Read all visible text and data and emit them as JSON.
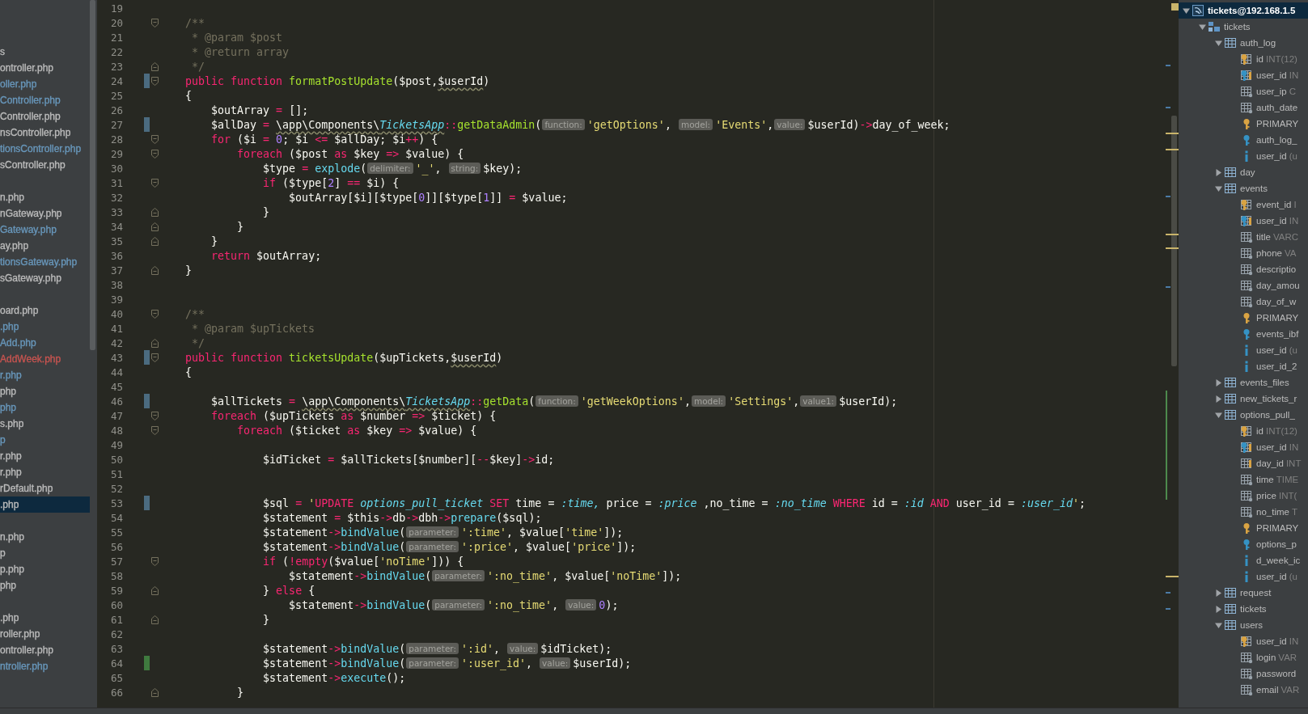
{
  "project": {
    "groups": [
      {
        "items": [
          {
            "name": "s",
            "color": "#bbbbbb",
            "selected": false
          },
          {
            "name": "ontroller.php",
            "color": "#bbbbbb",
            "selected": false
          },
          {
            "name": "oller.php",
            "color": "#6897bb",
            "selected": false
          },
          {
            "name": "Controller.php",
            "color": "#6897bb",
            "selected": false
          },
          {
            "name": "Controller.php",
            "color": "#bbbbbb",
            "selected": false
          },
          {
            "name": "nsController.php",
            "color": "#bbbbbb",
            "selected": false
          },
          {
            "name": "tionsController.php",
            "color": "#6897bb",
            "selected": false
          },
          {
            "name": "sController.php",
            "color": "#bbbbbb",
            "selected": false
          }
        ]
      },
      {
        "items": [
          {
            "name": "n.php",
            "color": "#bbbbbb",
            "selected": false
          },
          {
            "name": "nGateway.php",
            "color": "#bbbbbb",
            "selected": false
          },
          {
            "name": "Gateway.php",
            "color": "#6897bb",
            "selected": false
          },
          {
            "name": "ay.php",
            "color": "#bbbbbb",
            "selected": false
          },
          {
            "name": "tionsGateway.php",
            "color": "#6897bb",
            "selected": false
          },
          {
            "name": "sGateway.php",
            "color": "#bbbbbb",
            "selected": false
          }
        ]
      },
      {
        "items": [
          {
            "name": "oard.php",
            "color": "#bbbbbb",
            "selected": false
          },
          {
            "name": ".php",
            "color": "#6897bb",
            "selected": false
          },
          {
            "name": "Add.php",
            "color": "#6897bb",
            "selected": false
          },
          {
            "name": "AddWeek.php",
            "color": "#c75450",
            "selected": false
          },
          {
            "name": "r.php",
            "color": "#6897bb",
            "selected": false
          },
          {
            "name": "php",
            "color": "#bbbbbb",
            "selected": false
          },
          {
            "name": "php",
            "color": "#6897bb",
            "selected": false
          },
          {
            "name": "s.php",
            "color": "#bbbbbb",
            "selected": false
          },
          {
            "name": "p",
            "color": "#6897bb",
            "selected": false
          },
          {
            "name": "r.php",
            "color": "#bbbbbb",
            "selected": false
          },
          {
            "name": "r.php",
            "color": "#bbbbbb",
            "selected": false
          },
          {
            "name": "rDefault.php",
            "color": "#bbbbbb",
            "selected": false
          },
          {
            "name": ".php",
            "color": "#bbbbbb",
            "selected": true
          }
        ]
      },
      {
        "items": [
          {
            "name": "n.php",
            "color": "#bbbbbb",
            "selected": false
          },
          {
            "name": "p",
            "color": "#bbbbbb",
            "selected": false
          },
          {
            "name": "p.php",
            "color": "#bbbbbb",
            "selected": false
          },
          {
            "name": "php",
            "color": "#bbbbbb",
            "selected": false
          }
        ]
      },
      {
        "items": [
          {
            "name": ".php",
            "color": "#bbbbbb",
            "selected": false
          },
          {
            "name": "roller.php",
            "color": "#bbbbbb",
            "selected": false
          },
          {
            "name": "ontroller.php",
            "color": "#bbbbbb",
            "selected": false
          },
          {
            "name": "ntroller.php",
            "color": "#6897bb",
            "selected": false
          }
        ]
      }
    ]
  },
  "editor": {
    "lines": [
      {
        "n": "19"
      },
      {
        "n": "20",
        "fold": {
          "kind": "open"
        },
        "tokens": [
          {
            "kind": "cm",
            "text": "    /**"
          }
        ]
      },
      {
        "n": "21",
        "tokens": [
          {
            "kind": "cm",
            "text": "     * @param $post"
          }
        ]
      },
      {
        "n": "22",
        "tokens": [
          {
            "kind": "cm",
            "text": "     * @return array"
          }
        ]
      },
      {
        "n": "23",
        "fold": {
          "kind": "close"
        },
        "tokens": [
          {
            "kind": "cm",
            "text": "     */"
          }
        ]
      },
      {
        "n": "24",
        "fold": {
          "kind": "open"
        },
        "change": {
          "color": "#4b6b80"
        },
        "tokens": [
          {
            "kind": "kw",
            "text": "    public function "
          },
          {
            "kind": "fn",
            "text": "formatPostUpdate"
          },
          {
            "kind": "txt",
            "text": "($post,"
          },
          {
            "kind": "warn",
            "text": "$userId"
          },
          {
            "kind": "txt",
            "text": ")"
          }
        ]
      },
      {
        "n": "25",
        "tokens": [
          {
            "kind": "txt",
            "text": "    {"
          }
        ]
      },
      {
        "n": "26",
        "tokens": [
          {
            "kind": "txt",
            "text": "        $outArray "
          },
          {
            "kind": "kw",
            "text": "="
          },
          {
            "kind": "txt",
            "text": " [];"
          }
        ]
      },
      {
        "n": "27",
        "change": {
          "color": "#4b6b80"
        },
        "tokens": [
          {
            "kind": "txt",
            "text": "        $allDay "
          },
          {
            "kind": "kw",
            "text": "= "
          },
          {
            "kind": "ns",
            "text": "\\app\\Components\\"
          },
          {
            "kind": "cls",
            "text": "TicketsApp"
          },
          {
            "kind": "kw",
            "text": "::"
          },
          {
            "kind": "fn",
            "text": "getDataAdmin"
          },
          {
            "kind": "txt",
            "text": "("
          },
          {
            "kind": "hint",
            "text": "function:"
          },
          {
            "kind": "str",
            "text": "'getOptions'"
          },
          {
            "kind": "txt",
            "text": ", "
          },
          {
            "kind": "hint",
            "text": "model:"
          },
          {
            "kind": "str",
            "text": "'Events'"
          },
          {
            "kind": "txt",
            "text": ","
          },
          {
            "kind": "hint",
            "text": "value:"
          },
          {
            "kind": "txt",
            "text": "$userId)"
          },
          {
            "kind": "kw",
            "text": "->"
          },
          {
            "kind": "txt",
            "text": "day_of_week;"
          }
        ]
      },
      {
        "n": "28",
        "fold": {
          "kind": "open"
        },
        "tokens": [
          {
            "kind": "kw",
            "text": "        for"
          },
          {
            "kind": "txt",
            "text": " ($i "
          },
          {
            "kind": "kw",
            "text": "= "
          },
          {
            "kind": "num",
            "text": "0"
          },
          {
            "kind": "txt",
            "text": "; $i "
          },
          {
            "kind": "kw",
            "text": "<="
          },
          {
            "kind": "txt",
            "text": " $allDay; $i"
          },
          {
            "kind": "kw",
            "text": "++"
          },
          {
            "kind": "txt",
            "text": ") {"
          }
        ]
      },
      {
        "n": "29",
        "fold": {
          "kind": "open"
        },
        "tokens": [
          {
            "kind": "kw",
            "text": "            foreach"
          },
          {
            "kind": "txt",
            "text": " ($post "
          },
          {
            "kind": "kw",
            "text": "as"
          },
          {
            "kind": "txt",
            "text": " $key "
          },
          {
            "kind": "kw",
            "text": "=>"
          },
          {
            "kind": "txt",
            "text": " $value) {"
          }
        ]
      },
      {
        "n": "30",
        "tokens": [
          {
            "kind": "txt",
            "text": "                $type "
          },
          {
            "kind": "kw",
            "text": "= "
          },
          {
            "kind": "call",
            "text": "explode"
          },
          {
            "kind": "txt",
            "text": "("
          },
          {
            "kind": "hint",
            "text": "delimiter:"
          },
          {
            "kind": "str",
            "text": "'_'"
          },
          {
            "kind": "txt",
            "text": ", "
          },
          {
            "kind": "hint",
            "text": "string:"
          },
          {
            "kind": "txt",
            "text": "$key);"
          }
        ]
      },
      {
        "n": "31",
        "fold": {
          "kind": "open"
        },
        "tokens": [
          {
            "kind": "kw",
            "text": "                if"
          },
          {
            "kind": "txt",
            "text": " ($type["
          },
          {
            "kind": "num",
            "text": "2"
          },
          {
            "kind": "txt",
            "text": "] "
          },
          {
            "kind": "kw",
            "text": "=="
          },
          {
            "kind": "txt",
            "text": " $i) {"
          }
        ]
      },
      {
        "n": "32",
        "tokens": [
          {
            "kind": "txt",
            "text": "                    $outArray[$i][$type["
          },
          {
            "kind": "num",
            "text": "0"
          },
          {
            "kind": "txt",
            "text": "]][$type["
          },
          {
            "kind": "num",
            "text": "1"
          },
          {
            "kind": "txt",
            "text": "]] "
          },
          {
            "kind": "kw",
            "text": "="
          },
          {
            "kind": "txt",
            "text": " $value;"
          }
        ]
      },
      {
        "n": "33",
        "fold": {
          "kind": "close"
        },
        "tokens": [
          {
            "kind": "txt",
            "text": "                }"
          }
        ]
      },
      {
        "n": "34",
        "fold": {
          "kind": "close"
        },
        "tokens": [
          {
            "kind": "txt",
            "text": "            }"
          }
        ]
      },
      {
        "n": "35",
        "fold": {
          "kind": "close"
        },
        "tokens": [
          {
            "kind": "txt",
            "text": "        }"
          }
        ]
      },
      {
        "n": "36",
        "tokens": [
          {
            "kind": "kw",
            "text": "        return"
          },
          {
            "kind": "txt",
            "text": " $outArray;"
          }
        ]
      },
      {
        "n": "37",
        "fold": {
          "kind": "close"
        },
        "tokens": [
          {
            "kind": "txt",
            "text": "    }"
          }
        ]
      },
      {
        "n": "38"
      },
      {
        "n": "39"
      },
      {
        "n": "40",
        "fold": {
          "kind": "open"
        },
        "tokens": [
          {
            "kind": "cm",
            "text": "    /**"
          }
        ]
      },
      {
        "n": "41",
        "tokens": [
          {
            "kind": "cm",
            "text": "     * @param $upTickets"
          }
        ]
      },
      {
        "n": "42",
        "fold": {
          "kind": "close"
        },
        "tokens": [
          {
            "kind": "cm",
            "text": "     */"
          }
        ]
      },
      {
        "n": "43",
        "fold": {
          "kind": "open"
        },
        "change": {
          "color": "#4b6b80"
        },
        "tokens": [
          {
            "kind": "kw",
            "text": "    public function "
          },
          {
            "kind": "fn",
            "text": "ticketsUpdate"
          },
          {
            "kind": "txt",
            "text": "($upTickets,"
          },
          {
            "kind": "warn",
            "text": "$userId"
          },
          {
            "kind": "txt",
            "text": ")"
          }
        ]
      },
      {
        "n": "44",
        "tokens": [
          {
            "kind": "txt",
            "text": "    {"
          }
        ]
      },
      {
        "n": "45"
      },
      {
        "n": "46",
        "change": {
          "color": "#4b6b80"
        },
        "tokens": [
          {
            "kind": "txt",
            "text": "        $allTickets "
          },
          {
            "kind": "kw",
            "text": "= "
          },
          {
            "kind": "ns",
            "text": "\\app\\Components\\"
          },
          {
            "kind": "cls",
            "text": "TicketsApp"
          },
          {
            "kind": "kw",
            "text": "::"
          },
          {
            "kind": "fn",
            "text": "getData"
          },
          {
            "kind": "txt",
            "text": "("
          },
          {
            "kind": "hint",
            "text": "function:"
          },
          {
            "kind": "str",
            "text": "'getWeekOptions'"
          },
          {
            "kind": "txt",
            "text": ","
          },
          {
            "kind": "hint",
            "text": "model:"
          },
          {
            "kind": "str",
            "text": "'Settings'"
          },
          {
            "kind": "txt",
            "text": ","
          },
          {
            "kind": "hint",
            "text": "value1:"
          },
          {
            "kind": "txt",
            "text": "$userId);"
          }
        ]
      },
      {
        "n": "47",
        "fold": {
          "kind": "open"
        },
        "tokens": [
          {
            "kind": "kw",
            "text": "        foreach"
          },
          {
            "kind": "txt",
            "text": " ($upTickets "
          },
          {
            "kind": "kw",
            "text": "as"
          },
          {
            "kind": "txt",
            "text": " $number "
          },
          {
            "kind": "kw",
            "text": "=>"
          },
          {
            "kind": "txt",
            "text": " $ticket) {"
          }
        ]
      },
      {
        "n": "48",
        "fold": {
          "kind": "open"
        },
        "tokens": [
          {
            "kind": "kw",
            "text": "            foreach"
          },
          {
            "kind": "txt",
            "text": " ($ticket "
          },
          {
            "kind": "kw",
            "text": "as"
          },
          {
            "kind": "txt",
            "text": " $key "
          },
          {
            "kind": "kw",
            "text": "=>"
          },
          {
            "kind": "txt",
            "text": " $value) {"
          }
        ]
      },
      {
        "n": "49"
      },
      {
        "n": "50",
        "tokens": [
          {
            "kind": "txt",
            "text": "                $idTicket "
          },
          {
            "kind": "kw",
            "text": "="
          },
          {
            "kind": "txt",
            "text": " $allTickets[$number]["
          },
          {
            "kind": "kw",
            "text": "--"
          },
          {
            "kind": "txt",
            "text": "$key]"
          },
          {
            "kind": "kw",
            "text": "->"
          },
          {
            "kind": "txt",
            "text": "id;"
          }
        ]
      },
      {
        "n": "51"
      },
      {
        "n": "52"
      },
      {
        "n": "53",
        "change": {
          "color": "#4b6b80"
        },
        "tokens": [
          {
            "kind": "txt",
            "text": "                $sql "
          },
          {
            "kind": "kw",
            "text": "= "
          },
          {
            "kind": "str",
            "text": "'"
          },
          {
            "kind": "sqlkw",
            "text": "UPDATE "
          },
          {
            "kind": "sqlid",
            "text": "options_pull_ticket "
          },
          {
            "kind": "sqlkw",
            "text": "SET"
          },
          {
            "kind": "txt",
            "text": " time = "
          },
          {
            "kind": "sqlid",
            "text": ":time,"
          },
          {
            "kind": "txt",
            "text": " price = "
          },
          {
            "kind": "sqlid",
            "text": ":price"
          },
          {
            "kind": "txt",
            "text": " ,no_time = "
          },
          {
            "kind": "sqlid",
            "text": ":no_time "
          },
          {
            "kind": "sqlkw",
            "text": "WHERE"
          },
          {
            "kind": "txt",
            "text": " id = "
          },
          {
            "kind": "sqlid",
            "text": ":id "
          },
          {
            "kind": "sqlkw",
            "text": "AND"
          },
          {
            "kind": "txt",
            "text": " user_id = "
          },
          {
            "kind": "sqlid",
            "text": ":user_id"
          },
          {
            "kind": "str",
            "text": "'"
          },
          {
            "kind": "txt",
            "text": ";"
          }
        ]
      },
      {
        "n": "54",
        "tokens": [
          {
            "kind": "txt",
            "text": "                $statement "
          },
          {
            "kind": "kw",
            "text": "="
          },
          {
            "kind": "txt",
            "text": " $this"
          },
          {
            "kind": "kw",
            "text": "->"
          },
          {
            "kind": "txt",
            "text": "db"
          },
          {
            "kind": "kw",
            "text": "->"
          },
          {
            "kind": "txt",
            "text": "dbh"
          },
          {
            "kind": "kw",
            "text": "->"
          },
          {
            "kind": "call",
            "text": "prepare"
          },
          {
            "kind": "txt",
            "text": "($sql);"
          }
        ]
      },
      {
        "n": "55",
        "tokens": [
          {
            "kind": "txt",
            "text": "                $statement"
          },
          {
            "kind": "kw",
            "text": "->"
          },
          {
            "kind": "call",
            "text": "bindValue"
          },
          {
            "kind": "txt",
            "text": "("
          },
          {
            "kind": "hint",
            "text": "parameter:"
          },
          {
            "kind": "str",
            "text": "':time'"
          },
          {
            "kind": "txt",
            "text": ", $value["
          },
          {
            "kind": "str",
            "text": "'time'"
          },
          {
            "kind": "txt",
            "text": "]);"
          }
        ]
      },
      {
        "n": "56",
        "tokens": [
          {
            "kind": "txt",
            "text": "                $statement"
          },
          {
            "kind": "kw",
            "text": "->"
          },
          {
            "kind": "call",
            "text": "bindValue"
          },
          {
            "kind": "txt",
            "text": "("
          },
          {
            "kind": "hint",
            "text": "parameter:"
          },
          {
            "kind": "str",
            "text": "':price'"
          },
          {
            "kind": "txt",
            "text": ", $value["
          },
          {
            "kind": "str",
            "text": "'price'"
          },
          {
            "kind": "txt",
            "text": "]);"
          }
        ]
      },
      {
        "n": "57",
        "fold": {
          "kind": "open"
        },
        "tokens": [
          {
            "kind": "kw",
            "text": "                if"
          },
          {
            "kind": "txt",
            "text": " ("
          },
          {
            "kind": "kw",
            "text": "!empty"
          },
          {
            "kind": "txt",
            "text": "($value["
          },
          {
            "kind": "str",
            "text": "'noTime'"
          },
          {
            "kind": "txt",
            "text": "])) {"
          }
        ]
      },
      {
        "n": "58",
        "tokens": [
          {
            "kind": "txt",
            "text": "                    $statement"
          },
          {
            "kind": "kw",
            "text": "->"
          },
          {
            "kind": "call",
            "text": "bindValue"
          },
          {
            "kind": "txt",
            "text": "("
          },
          {
            "kind": "hint",
            "text": "parameter:"
          },
          {
            "kind": "str",
            "text": "':no_time'"
          },
          {
            "kind": "txt",
            "text": ", $value["
          },
          {
            "kind": "str",
            "text": "'noTime'"
          },
          {
            "kind": "txt",
            "text": "]);"
          }
        ]
      },
      {
        "n": "59",
        "fold": {
          "kind": "close"
        },
        "tokens": [
          {
            "kind": "txt",
            "text": "                } "
          },
          {
            "kind": "kw",
            "text": "else"
          },
          {
            "kind": "txt",
            "text": " {"
          }
        ]
      },
      {
        "n": "60",
        "tokens": [
          {
            "kind": "txt",
            "text": "                    $statement"
          },
          {
            "kind": "kw",
            "text": "->"
          },
          {
            "kind": "call",
            "text": "bindValue"
          },
          {
            "kind": "txt",
            "text": "("
          },
          {
            "kind": "hint",
            "text": "parameter:"
          },
          {
            "kind": "str",
            "text": "':no_time'"
          },
          {
            "kind": "txt",
            "text": ", "
          },
          {
            "kind": "hint",
            "text": "value:"
          },
          {
            "kind": "num",
            "text": "0"
          },
          {
            "kind": "txt",
            "text": ");"
          }
        ]
      },
      {
        "n": "61",
        "fold": {
          "kind": "close"
        },
        "tokens": [
          {
            "kind": "txt",
            "text": "                }"
          }
        ]
      },
      {
        "n": "62"
      },
      {
        "n": "63",
        "tokens": [
          {
            "kind": "txt",
            "text": "                $statement"
          },
          {
            "kind": "kw",
            "text": "->"
          },
          {
            "kind": "call",
            "text": "bindValue"
          },
          {
            "kind": "txt",
            "text": "("
          },
          {
            "kind": "hint",
            "text": "parameter:"
          },
          {
            "kind": "str",
            "text": "':id'"
          },
          {
            "kind": "txt",
            "text": ", "
          },
          {
            "kind": "hint",
            "text": "value:"
          },
          {
            "kind": "txt",
            "text": "$idTicket);"
          }
        ]
      },
      {
        "n": "64",
        "change": {
          "color": "#3f7a3f"
        },
        "tokens": [
          {
            "kind": "txt",
            "text": "                $statement"
          },
          {
            "kind": "kw",
            "text": "->"
          },
          {
            "kind": "call",
            "text": "bindValue"
          },
          {
            "kind": "txt",
            "text": "("
          },
          {
            "kind": "hint",
            "text": "parameter:"
          },
          {
            "kind": "str",
            "text": "':user_id'"
          },
          {
            "kind": "txt",
            "text": ", "
          },
          {
            "kind": "hint",
            "text": "value:"
          },
          {
            "kind": "txt",
            "text": "$userId);"
          }
        ]
      },
      {
        "n": "65",
        "tokens": [
          {
            "kind": "txt",
            "text": "                $statement"
          },
          {
            "kind": "kw",
            "text": "->"
          },
          {
            "kind": "call",
            "text": "execute"
          },
          {
            "kind": "txt",
            "text": "();"
          }
        ]
      },
      {
        "n": "66",
        "fold": {
          "kind": "close"
        },
        "tokens": [
          {
            "kind": "txt",
            "text": "            }"
          }
        ]
      }
    ]
  },
  "database": {
    "tree": [
      {
        "kind": "datasource",
        "name": "tickets@192.168.1.5",
        "expanded": true,
        "selected": true,
        "children": [
          {
            "kind": "schema",
            "name": "tickets",
            "expanded": true,
            "selected": false,
            "children": [
              {
                "kind": "table",
                "name": "auth_log",
                "expanded": true,
                "selected": false,
                "children": [
                  {
                    "kind": "pk",
                    "name": "id",
                    "type": "INT(12)",
                    "selected": false
                  },
                  {
                    "kind": "fk",
                    "name": "user_id",
                    "type": "IN",
                    "selected": false
                  },
                  {
                    "kind": "column",
                    "name": "user_ip",
                    "type": "C",
                    "selected": false
                  },
                  {
                    "kind": "column",
                    "name": "auth_date",
                    "selected": false
                  },
                  {
                    "kind": "key",
                    "name": "PRIMARY",
                    "selected": false
                  },
                  {
                    "kind": "fkey",
                    "name": "auth_log_",
                    "selected": false
                  },
                  {
                    "kind": "index",
                    "name": "user_id",
                    "type": "(u",
                    "selected": false
                  }
                ]
              },
              {
                "kind": "table",
                "name": "day",
                "expanded": false,
                "selected": false
              },
              {
                "kind": "table",
                "name": "events",
                "expanded": true,
                "selected": false,
                "children": [
                  {
                    "kind": "pk",
                    "name": "event_id",
                    "type": "I",
                    "selected": false
                  },
                  {
                    "kind": "fk",
                    "name": "user_id",
                    "type": "IN",
                    "selected": false
                  },
                  {
                    "kind": "column",
                    "name": "title",
                    "type": "VARC",
                    "selected": false
                  },
                  {
                    "kind": "column",
                    "name": "phone",
                    "type": "VA",
                    "selected": false
                  },
                  {
                    "kind": "column",
                    "name": "descriptio",
                    "selected": false
                  },
                  {
                    "kind": "column",
                    "name": "day_amou",
                    "selected": false
                  },
                  {
                    "kind": "column",
                    "name": "day_of_w",
                    "selected": false
                  },
                  {
                    "kind": "key",
                    "name": "PRIMARY",
                    "selected": false
                  },
                  {
                    "kind": "fkey",
                    "name": "events_ibf",
                    "selected": false
                  },
                  {
                    "kind": "index",
                    "name": "user_id",
                    "type": "(u",
                    "selected": false
                  },
                  {
                    "kind": "index",
                    "name": "user_id_2",
                    "selected": false
                  }
                ]
              },
              {
                "kind": "table",
                "name": "events_files",
                "expanded": false,
                "selected": false
              },
              {
                "kind": "table",
                "name": "new_tickets_r",
                "expanded": false,
                "selected": false
              },
              {
                "kind": "table",
                "name": "options_pull_",
                "expanded": true,
                "selected": false,
                "children": [
                  {
                    "kind": "pk",
                    "name": "id",
                    "type": "INT(12)",
                    "selected": false
                  },
                  {
                    "kind": "fk",
                    "name": "user_id",
                    "type": "IN",
                    "selected": false
                  },
                  {
                    "kind": "ref",
                    "name": "day_id",
                    "type": "INT",
                    "selected": false
                  },
                  {
                    "kind": "column",
                    "name": "time",
                    "type": "TIME",
                    "selected": false
                  },
                  {
                    "kind": "column",
                    "name": "price",
                    "type": "INT(",
                    "selected": false
                  },
                  {
                    "kind": "column",
                    "name": "no_time",
                    "type": "T",
                    "selected": false
                  },
                  {
                    "kind": "key",
                    "name": "PRIMARY",
                    "selected": false
                  },
                  {
                    "kind": "fkey",
                    "name": "options_p",
                    "selected": false
                  },
                  {
                    "kind": "index",
                    "name": "d_week_ic",
                    "selected": false
                  },
                  {
                    "kind": "index",
                    "name": "user_id",
                    "type": "(u",
                    "selected": false
                  }
                ]
              },
              {
                "kind": "table",
                "name": "request",
                "expanded": false,
                "selected": false
              },
              {
                "kind": "table",
                "name": "tickets",
                "expanded": false,
                "selected": false
              },
              {
                "kind": "table",
                "name": "users",
                "expanded": true,
                "selected": false,
                "children": [
                  {
                    "kind": "pk",
                    "name": "user_id",
                    "type": "IN",
                    "selected": false
                  },
                  {
                    "kind": "column",
                    "name": "login",
                    "type": "VAR",
                    "selected": false
                  },
                  {
                    "kind": "column",
                    "name": "password",
                    "selected": false
                  },
                  {
                    "kind": "column",
                    "name": "email",
                    "type": "VAR",
                    "selected": false
                  }
                ]
              }
            ]
          }
        ]
      }
    ]
  }
}
